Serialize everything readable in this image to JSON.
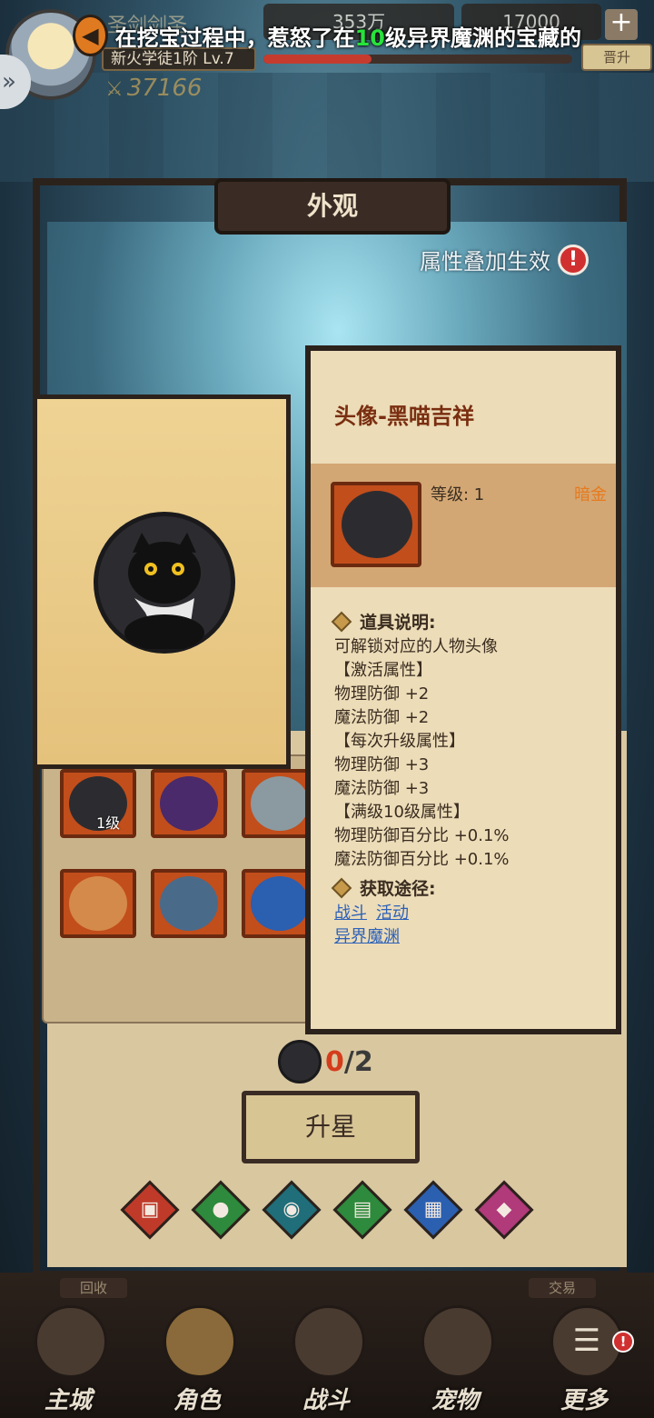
{
  "player": {
    "name": "圣剑剑圣",
    "rank": "新火学徒1阶 Lv.7",
    "power": "37166",
    "xp_fraction": 0.35
  },
  "resources": {
    "gold": "353万",
    "gems": "17000"
  },
  "header": {
    "upgrade_label": "晋升"
  },
  "marquee": {
    "before": "在挖宝过程中，惹怒了在",
    "level": "10",
    "after": "级异界魔渊的宝藏的"
  },
  "panel": {
    "title": "外观",
    "attr_stack_label": "属性叠加生效",
    "alert_symbol": "!"
  },
  "inventory": {
    "slots": [
      {
        "icon": "black-cat-avatar",
        "level": "1级"
      },
      {
        "icon": "purple-hair-avatar",
        "level": ""
      },
      {
        "icon": "silver-hair-avatar",
        "level": ""
      },
      {
        "icon": "crossed-swords-emblem",
        "level": ""
      },
      {
        "icon": "winged-shield-emblem",
        "level": ""
      },
      {
        "icon": "lion-shield-emblem",
        "level": ""
      }
    ]
  },
  "detail": {
    "title": "头像-黑喵吉祥",
    "level": "等级: 1",
    "quality": "暗金",
    "item_desc_head": "道具说明:",
    "lines": [
      "可解锁对应的人物头像",
      "【激活属性】",
      "物理防御 +2",
      "魔法防御 +2",
      "【每次升级属性】",
      "物理防御 +3",
      "魔法防御 +3",
      "【满级10级属性】",
      "物理防御百分比 +0.1%",
      "魔法防御百分比 +0.1%"
    ],
    "source_head": "获取途径:",
    "sources_row1": [
      "战斗",
      "活动"
    ],
    "sources_row2": [
      "异界魔渊"
    ]
  },
  "upgrade": {
    "have": "0",
    "need": "/2",
    "button_label": "升星"
  },
  "tabs": [
    {
      "icon": "clothes-icon",
      "color": "#c03a2a"
    },
    {
      "icon": "person-icon",
      "color": "#2e8a3c"
    },
    {
      "icon": "portrait-frame-icon",
      "color": "#1f6e7a"
    },
    {
      "icon": "chat-bubble-icon",
      "color": "#2e8a3c"
    },
    {
      "icon": "id-card-icon",
      "color": "#2b5fb0"
    },
    {
      "icon": "ribbon-icon",
      "color": "#b03a7a"
    }
  ],
  "bottom_nav": {
    "tag_left": "回收",
    "tag_right": "交易",
    "items": [
      {
        "label": "主城",
        "icon": "castle-icon"
      },
      {
        "label": "角色",
        "icon": "helmet-icon"
      },
      {
        "label": "战斗",
        "icon": "crossbow-icon"
      },
      {
        "label": "宠物",
        "icon": "owl-mask-icon"
      },
      {
        "label": "更多",
        "icon": "menu-icon"
      }
    ],
    "badge": "!"
  }
}
